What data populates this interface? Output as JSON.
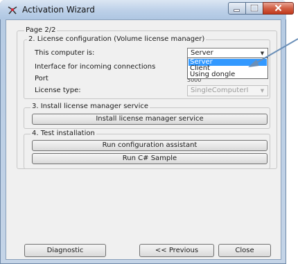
{
  "window": {
    "title": "Activation Wizard"
  },
  "page_indicator": "Page 2/2",
  "license_config": {
    "caption": "2. License configuration (Volume license manager)",
    "computer_label": "This computer is:",
    "computer_value": "Server",
    "computer_options": [
      "Server",
      "Client",
      "Using dongle"
    ],
    "computer_selected_index": 0,
    "interface_label": "Interface for incoming connections",
    "port_label": "Port",
    "port_value": "5000",
    "license_type_label": "License type:",
    "license_type_value": "SingleComputerI"
  },
  "install_service": {
    "caption": "3. Install license manager service",
    "button": "Install license manager service"
  },
  "test_installation": {
    "caption": "4. Test installation",
    "run_config_button": "Run configuration assistant",
    "run_sample_button": "Run C# Sample"
  },
  "footer": {
    "diagnostic_button": "Diagnostic",
    "previous_button": "<< Previous",
    "close_button": "Close"
  },
  "icons": {
    "app": "wizard-app-icon",
    "minimize": "minimize-icon",
    "maximize": "maximize-icon",
    "close": "close-icon",
    "combo_arrow": "chevron-down-icon"
  },
  "colors": {
    "selection": "#3399ff",
    "close_button": "#c2391c",
    "title_bar": "#bcd0e8",
    "annotation_arrow": "#6a8fb8"
  }
}
